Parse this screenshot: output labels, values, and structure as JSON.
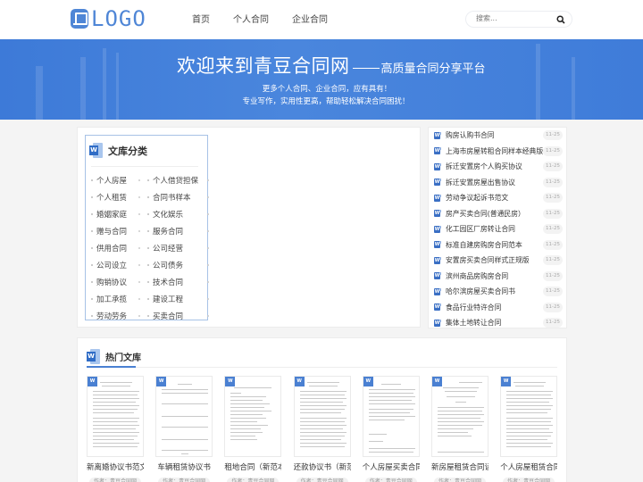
{
  "header": {
    "logo_text": "LOGO",
    "nav": [
      "首页",
      "个人合同",
      "企业合同"
    ],
    "search_placeholder": "搜索..."
  },
  "banner": {
    "title": "欢迎来到青豆合同网",
    "subtitle": "高质量合同分享平台",
    "line1": "更多个人合同、企业合同，应有具有！",
    "line2": "专业写作，实用性更高，帮助轻松解决合同困扰！"
  },
  "categories": {
    "title": "文库分类",
    "items": [
      [
        "个人房屋",
        "个人借贷担保"
      ],
      [
        "个人租赁",
        "合同书样本"
      ],
      [
        "婚姻家庭",
        "文化娱乐"
      ],
      [
        "赠与合同",
        "服务合同"
      ],
      [
        "供用合同",
        "公司经营"
      ],
      [
        "公司设立",
        "公司债务"
      ],
      [
        "购销协议",
        "技术合同"
      ],
      [
        "加工承揽",
        "建设工程"
      ],
      [
        "劳动劳务",
        "买卖合同"
      ]
    ]
  },
  "recent": {
    "items": [
      {
        "title": "购房认购书合同",
        "date": "11-25"
      },
      {
        "title": "上海市房屋转租合同样本经典版",
        "date": "11-25"
      },
      {
        "title": "拆迁安置房个人购买协议",
        "date": "11-25"
      },
      {
        "title": "拆迁安置房屋出售协议",
        "date": "11-25"
      },
      {
        "title": "劳动争议起诉书范文",
        "date": "11-25"
      },
      {
        "title": "房产买卖合同(普通民房）",
        "date": "11-25"
      },
      {
        "title": "化工园区厂房转让合同",
        "date": "11-25"
      },
      {
        "title": "标准自建房购房合同范本",
        "date": "11-25"
      },
      {
        "title": "安置房买卖合同样式正规版",
        "date": "11-25"
      },
      {
        "title": "滨州商品房购房合同",
        "date": "11-25"
      },
      {
        "title": "哈尔滨房屋买卖合同书",
        "date": "11-25"
      },
      {
        "title": "食品行业特许合同",
        "date": "11-25"
      },
      {
        "title": "集体土地转让合同",
        "date": "11-25"
      }
    ]
  },
  "hot": {
    "title": "热门文库",
    "cards": [
      {
        "title": "新离婚协议书范文",
        "author": "作者：青豆合同网"
      },
      {
        "title": "车辆租赁协议书",
        "author": "作者：青豆合同网"
      },
      {
        "title": "租地合同（新范本",
        "author": "作者：青豆合同网"
      },
      {
        "title": "还款协议书（新范",
        "author": "作者：青豆合同网"
      },
      {
        "title": "个人房屋买卖合同",
        "author": "作者：青豆合同网"
      },
      {
        "title": "新房屋租赁合同读",
        "author": "作者：青豆合同网"
      },
      {
        "title": "个人房屋租赁合同",
        "author": "作者：青豆合同网"
      }
    ]
  },
  "colors": {
    "brand": "#4f86d6",
    "banner": "#4a86dd",
    "word_icon": "#2f6cc6"
  }
}
